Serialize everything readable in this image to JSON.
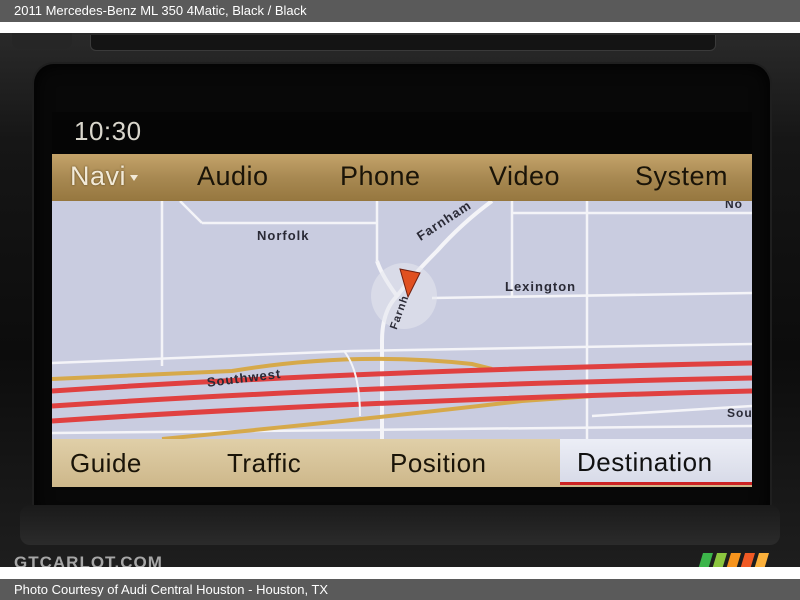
{
  "header": {
    "title": "2011 Mercedes-Benz ML 350 4Matic,  Black / Black"
  },
  "footer": {
    "credit": "Photo Courtesy of Audi Central Houston - Houston, TX"
  },
  "watermark": {
    "text": "GTCARLOT.COM"
  },
  "screen": {
    "clock": "10:30",
    "top_menu": [
      {
        "label": "Navi",
        "active": true
      },
      {
        "label": "Audio"
      },
      {
        "label": "Phone"
      },
      {
        "label": "Video"
      },
      {
        "label": "System"
      }
    ],
    "map": {
      "streets": [
        "Norfolk",
        "Farnham",
        "Lexington",
        "Southwest",
        "Farnh",
        "No",
        "Sou"
      ],
      "colors": {
        "background": "#c9cce0",
        "highway": "#e04040",
        "arterial": "#d6a94a",
        "street": "#f4f4f8",
        "position_marker": "#e05020"
      }
    },
    "bottom_menu": [
      {
        "label": "Guide"
      },
      {
        "label": "Traffic"
      },
      {
        "label": "Position"
      },
      {
        "label": "Destination",
        "active": true
      }
    ]
  }
}
